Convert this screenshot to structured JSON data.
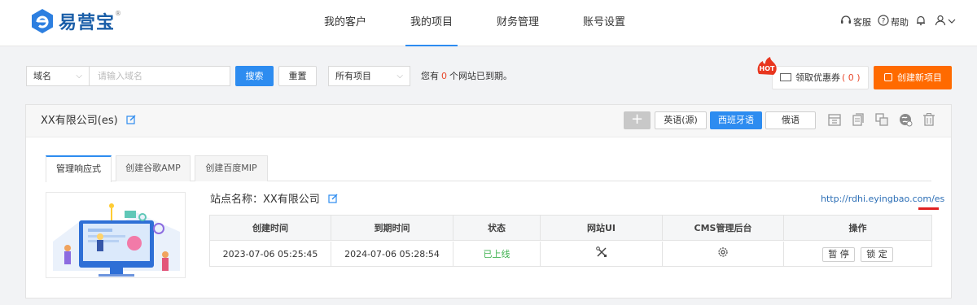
{
  "brand": {
    "name": "易营宝",
    "reg": "®",
    "color": "#1a5ea8"
  },
  "nav": {
    "items": [
      {
        "label": "我的客户",
        "active": false
      },
      {
        "label": "我的项目",
        "active": true
      },
      {
        "label": "财务管理",
        "active": false
      },
      {
        "label": "账号设置",
        "active": false
      }
    ]
  },
  "header_right": {
    "service": "客服",
    "help": "帮助"
  },
  "toolbar": {
    "domain_select": "域名",
    "domain_placeholder": "请输入域名",
    "search_label": "搜索",
    "reset_label": "重置",
    "project_select": "所有项目",
    "expire_prefix": "您有",
    "expire_count": "0",
    "expire_suffix": "个网站已到期。",
    "hot_badge": "HOT",
    "coupon_label": "领取优惠券",
    "coupon_count": "( 0 )",
    "create_label": "创建新项目"
  },
  "project": {
    "title": "XX有限公司(es)",
    "add_label": "+",
    "languages": [
      {
        "label": "英语(源)",
        "active": false
      },
      {
        "label": "西班牙语",
        "active": true
      },
      {
        "label": "俄语",
        "active": false
      }
    ],
    "tabs": [
      {
        "label": "管理响应式",
        "active": true
      },
      {
        "label": "创建谷歌AMP",
        "active": false
      },
      {
        "label": "创建百度MIP",
        "active": false
      }
    ],
    "site_name": "站点名称：XX有限公司",
    "site_url": "http://rdhi.eyingbao.com/es",
    "table": {
      "columns": [
        "创建时间",
        "到期时间",
        "状态",
        "网站UI",
        "CMS管理后台",
        "操作"
      ],
      "rows": [
        {
          "created": "2023-07-06 05:25:45",
          "expires": "2024-07-06 05:28:54",
          "status": "已上线",
          "ui_icon": "tools-icon",
          "cms_icon": "gear-icon",
          "actions": [
            "暂 停",
            "锁 定"
          ]
        }
      ]
    }
  },
  "colors": {
    "primary": "#2d8cf0",
    "orange": "#ff6a00",
    "danger": "#e8472b",
    "success": "#3eb24f"
  }
}
